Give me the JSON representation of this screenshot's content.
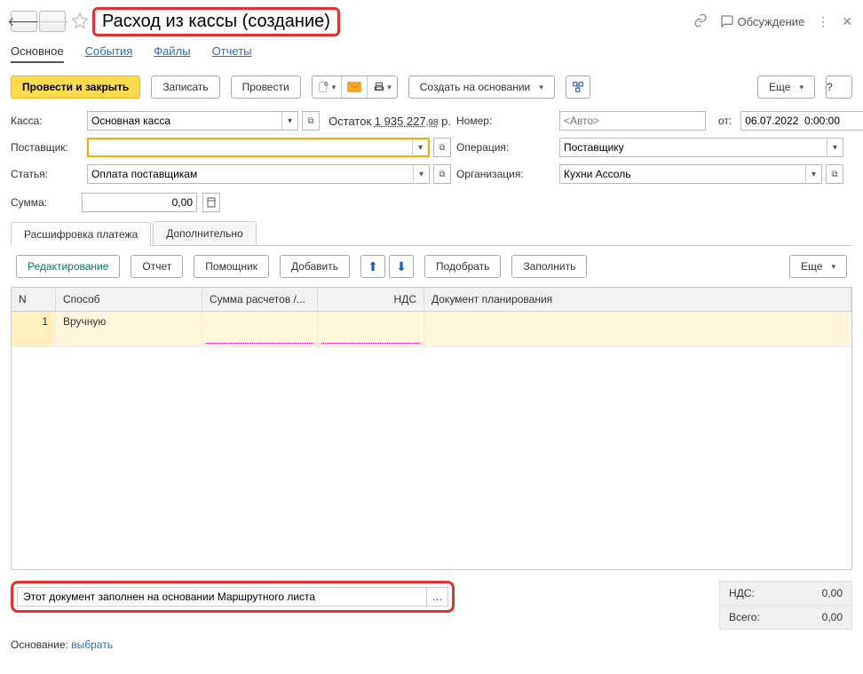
{
  "title": "Расход из кассы (создание)",
  "titlebar": {
    "discuss": "Обсуждение"
  },
  "navtabs": {
    "main": "Основное",
    "events": "События",
    "files": "Файлы",
    "reports": "Отчеты"
  },
  "cmdbar": {
    "post_close": "Провести и закрыть",
    "save": "Записать",
    "post": "Провести",
    "create_on_basis": "Создать на основании",
    "more": "Еще",
    "help": "?"
  },
  "form": {
    "cash_lbl": "Касса:",
    "cash_val": "Основная касса",
    "balance_lbl": "Остаток",
    "balance_main": "1 935 227",
    "balance_frac": ",98",
    "balance_cur": "р.",
    "number_lbl": "Номер:",
    "number_placeholder": "<Авто>",
    "from_lbl": "от:",
    "date_val": "06.07.2022  0:00:00",
    "supplier_lbl": "Поставщик:",
    "supplier_val": "",
    "operation_lbl": "Операция:",
    "operation_val": "Поставщику",
    "article_lbl": "Статья:",
    "article_val": "Оплата поставщикам",
    "org_lbl": "Организация:",
    "org_val": "Кухни Ассоль",
    "sum_lbl": "Сумма:",
    "sum_val": "0,00"
  },
  "ptabs": {
    "decode": "Расшифровка платежа",
    "extra": "Дополнительно"
  },
  "ptoolbar": {
    "edit": "Редактирование",
    "report": "Отчет",
    "assistant": "Помощник",
    "add": "Добавить",
    "pick": "Подобрать",
    "fill": "Заполнить",
    "more": "Еще"
  },
  "gridhead": {
    "n": "N",
    "method": "Способ",
    "sums": "Сумма расчетов /...",
    "vat": "НДС",
    "plan": "Документ планирования"
  },
  "gridrow": {
    "n": "1",
    "method": "Вручную"
  },
  "comment": "Этот документ заполнен на основании Маршрутного листа",
  "totals": {
    "vat_lbl": "НДС:",
    "vat_val": "0,00",
    "total_lbl": "Всего:",
    "total_val": "0,00"
  },
  "basis": {
    "lbl": "Основание:",
    "link": "выбрать"
  }
}
